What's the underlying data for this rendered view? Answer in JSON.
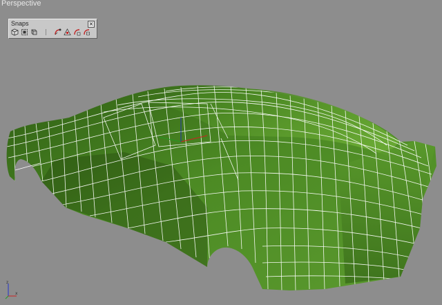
{
  "viewport": {
    "label": "Perspective"
  },
  "snaps_toolbar": {
    "title": "Snaps",
    "close_glyph": "×",
    "buttons": [
      {
        "icon": "3d-snap-toggle-icon"
      },
      {
        "icon": "angle-snap-toggle-icon"
      },
      {
        "icon": "percent-snap-toggle-icon"
      },
      {
        "icon": "spinner-snap-toggle-icon"
      },
      {
        "icon": "edge-snap-icon"
      },
      {
        "icon": "vertex-snap-icon"
      },
      {
        "icon": "face-snap-icon"
      }
    ]
  },
  "model": {
    "name": "car-body-wireframe-mesh",
    "fill_color": "#4a8a22",
    "wire_color": "#ffffff"
  },
  "axis_tripod": {
    "x_label": "x",
    "z_label": "z"
  }
}
